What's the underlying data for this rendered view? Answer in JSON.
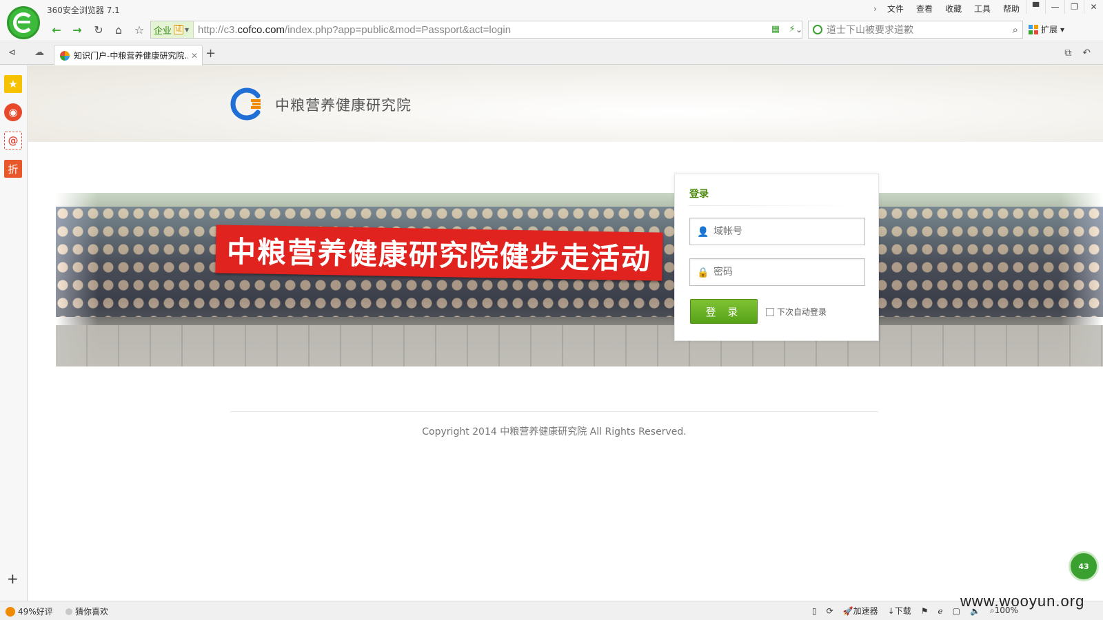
{
  "browser": {
    "title": "360安全浏览器 7.1",
    "menu": [
      "文件",
      "查看",
      "收藏",
      "工具",
      "帮助"
    ],
    "address": {
      "badge_label": "企业",
      "badge_cert": "证",
      "url_prefix": "http://c3.",
      "url_host": "cofco.com",
      "url_path": "/index.php?app=public&mod=Passport&act=login"
    },
    "search": {
      "value": "道士下山被要求道歉"
    },
    "extensions_label": "扩展",
    "tab": {
      "title": "知识门户-中粮营养健康研究院..."
    },
    "status": {
      "rating": "49%好评",
      "guess": "猜你喜欢",
      "accelerator": "加速器",
      "download": "下载",
      "zoom": "100%"
    },
    "watermark": "www.wooyun.org",
    "float_widget": "43"
  },
  "site": {
    "name": "中粮营养健康研究院",
    "banner_text": "中粮营养健康研究院健步走活动",
    "login": {
      "heading": "登录",
      "account_placeholder": "域帐号",
      "password_placeholder": "密码",
      "submit_label": "登 录",
      "remember_label": "下次自动登录"
    },
    "copyright": "Copyright 2014 中粮营养健康研究院 All Rights Reserved."
  },
  "colors": {
    "accent_green": "#56a218",
    "banner_red": "#e1231f",
    "logo_blue": "#1f6fd6",
    "logo_orange": "#f08a00"
  }
}
